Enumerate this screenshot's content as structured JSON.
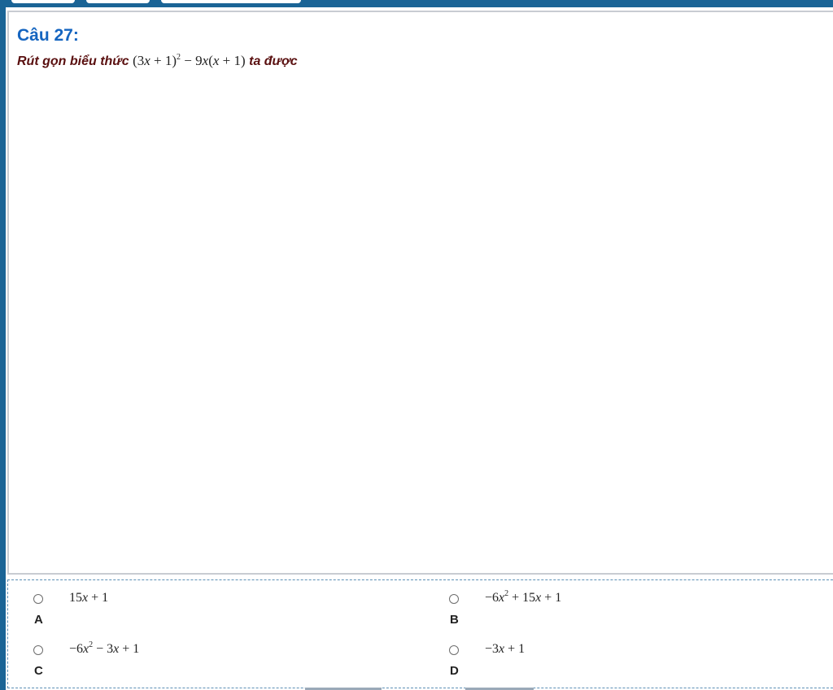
{
  "question": {
    "title": "Câu 27:",
    "prompt_before": "Rút gọn biểu thức",
    "prompt_after": "ta được"
  },
  "options": [
    {
      "letter": "A",
      "selected": false
    },
    {
      "letter": "B",
      "selected": false
    },
    {
      "letter": "C",
      "selected": false
    },
    {
      "letter": "D",
      "selected": false
    }
  ],
  "colors": {
    "header_blue": "#1a6496",
    "title_blue": "#1565c0",
    "prompt_maroon": "#5a1010",
    "answer_border": "#5b8fb5"
  }
}
